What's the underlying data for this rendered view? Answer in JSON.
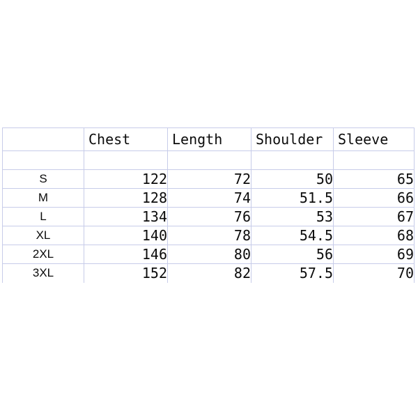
{
  "document": {
    "kind": "garment-size-chart",
    "background_color": "#ffffff",
    "gridline_color": "#c7cce9",
    "text_color": "#0b0b0b"
  },
  "table": {
    "corner_label": "",
    "columns": [
      {
        "key": "size",
        "label": ""
      },
      {
        "key": "chest",
        "label": "Chest"
      },
      {
        "key": "length",
        "label": "Length"
      },
      {
        "key": "shoulder",
        "label": "Shoulder"
      },
      {
        "key": "sleeve",
        "label": "Sleeve"
      }
    ],
    "spacer_row": {
      "size": "",
      "chest": "",
      "length": "",
      "shoulder": "",
      "sleeve": ""
    },
    "rows": [
      {
        "size": "S",
        "chest": "122",
        "length": "72",
        "shoulder": "50",
        "sleeve": "65"
      },
      {
        "size": "M",
        "chest": "128",
        "length": "74",
        "shoulder": "51.5",
        "sleeve": "66"
      },
      {
        "size": "L",
        "chest": "134",
        "length": "76",
        "shoulder": "53",
        "sleeve": "67"
      },
      {
        "size": "XL",
        "chest": "140",
        "length": "78",
        "shoulder": "54.5",
        "sleeve": "68"
      },
      {
        "size": "2XL",
        "chest": "146",
        "length": "80",
        "shoulder": "56",
        "sleeve": "69"
      },
      {
        "size": "3XL",
        "chest": "152",
        "length": "82",
        "shoulder": "57.5",
        "sleeve": "70"
      }
    ]
  }
}
